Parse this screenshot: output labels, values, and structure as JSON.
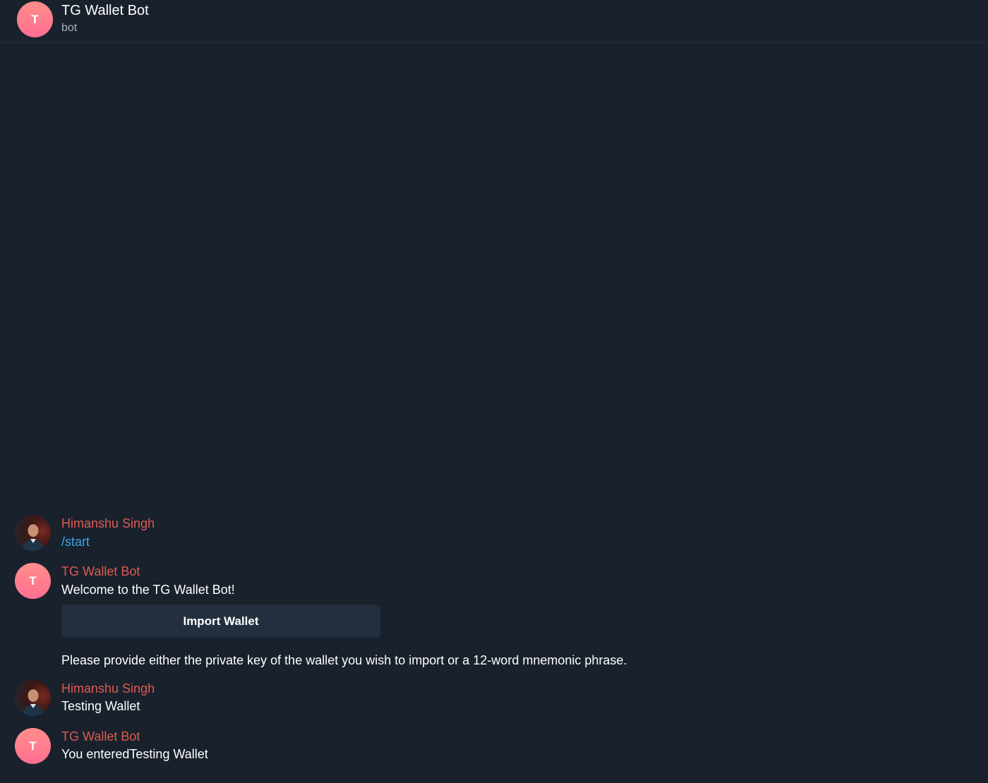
{
  "header": {
    "avatar_initial": "T",
    "title": "TG Wallet Bot",
    "subtitle": "bot"
  },
  "messages": [
    {
      "sender": "Himanshu Singh",
      "text": "/start",
      "is_command": true,
      "avatar": "user-photo"
    },
    {
      "sender": "TG Wallet Bot",
      "text": "Welcome to the TG Wallet Bot!",
      "avatar_initial": "T",
      "inline_button": "Import Wallet",
      "followup_text": "Please provide either the private key of the wallet you wish to import or a 12-word mnemonic phrase."
    },
    {
      "sender": "Himanshu Singh",
      "text": "Testing Wallet",
      "avatar": "user-photo"
    },
    {
      "sender": "TG Wallet Bot",
      "text": "You enteredTesting Wallet",
      "avatar_initial": "T"
    }
  ],
  "colors": {
    "background": "#18212c",
    "sender_name": "#e05a4f",
    "command_link": "#3ea6ea",
    "button_bg": "#232f3e",
    "avatar_gradient_top": "#ff8e8a",
    "avatar_gradient_bottom": "#ff6f92"
  }
}
